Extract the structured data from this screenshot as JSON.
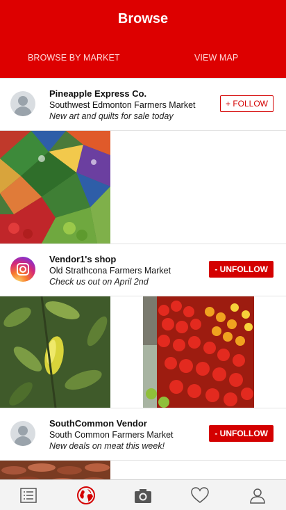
{
  "header": {
    "title": "Browse",
    "tabs": [
      "BROWSE BY MARKET",
      "VIEW MAP"
    ]
  },
  "posts": [
    {
      "vendor": "Pineapple Express Co.",
      "market": "Southwest Edmonton Farmers Market",
      "note": "New art and quilts for sale today",
      "button": "+ FOLLOW",
      "avatar": "default-user-avatar"
    },
    {
      "vendor": "Vendor1's shop",
      "market": "Old Strathcona Farmers Market",
      "note": "Check us out on April 2nd",
      "button": "- UNFOLLOW",
      "avatar": "instagram-avatar"
    },
    {
      "vendor": "SouthCommon Vendor",
      "market": "South Common Farmers Market",
      "note": "New deals on meat this week!",
      "button": "- UNFOLLOW",
      "avatar": "default-user-avatar"
    }
  ],
  "bottom_nav": [
    {
      "icon": "list-icon",
      "active": false
    },
    {
      "icon": "globe-icon",
      "active": true
    },
    {
      "icon": "camera-icon",
      "active": false
    },
    {
      "icon": "heart-icon",
      "active": false
    },
    {
      "icon": "user-icon",
      "active": false
    }
  ],
  "colors": {
    "brand_red": "#dd0000",
    "button_red": "#d40000",
    "nav_background": "#f3f3f3"
  }
}
